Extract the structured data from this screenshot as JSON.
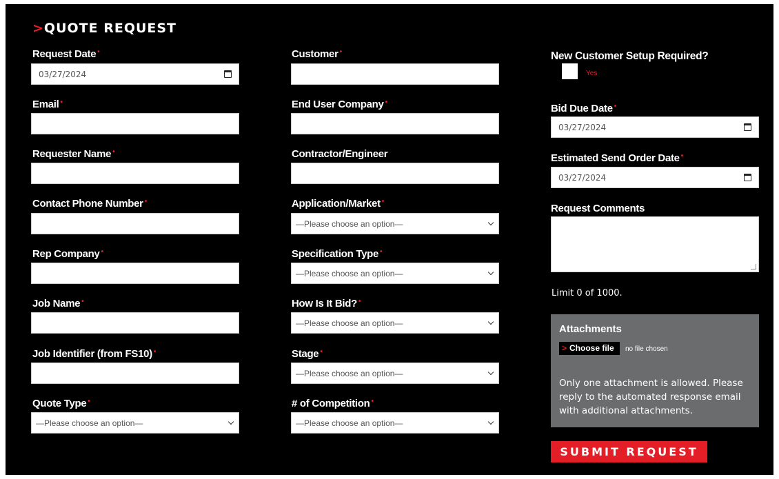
{
  "form": {
    "title_chevron": ">",
    "title": "QUOTE REQUEST",
    "required_mark": "•",
    "placeholder_option": "—Please choose an option—",
    "date_value": "03/27/2024",
    "col1": {
      "request_date": "Request Date",
      "email": "Email",
      "requester_name": "Requester Name",
      "contact_phone": "Contact Phone Number",
      "rep_company": "Rep Company",
      "job_name": "Job Name",
      "job_identifier": "Job Identifier (from FS10)",
      "quote_type": "Quote Type"
    },
    "col2": {
      "customer": "Customer",
      "end_user_company": "End User Company",
      "contractor_engineer": "Contractor/Engineer",
      "application_market": "Application/Market",
      "specification_type": "Specification Type",
      "how_is_it_bid": "How Is It Bid?",
      "stage": "Stage",
      "competition": "# of Competition"
    },
    "col3": {
      "new_customer": "New Customer Setup Required?",
      "yes": "Yes",
      "bid_due_date": "Bid Due Date",
      "estimated_send_order_date": "Estimated Send Order Date",
      "request_comments": "Request Comments",
      "limit": "Limit 0 of 1000."
    },
    "attachments": {
      "title": "Attachments",
      "chevron": ">",
      "choose_file": "Choose file",
      "no_file": "no file chosen",
      "note": "Only one attachment is allowed. Please reply to the automated response email with additional attachments."
    },
    "submit": "SUBMIT REQUEST",
    "colors": {
      "background": "#000000",
      "accent": "#e41e26",
      "attachments_bg": "#6b6c6e"
    }
  }
}
